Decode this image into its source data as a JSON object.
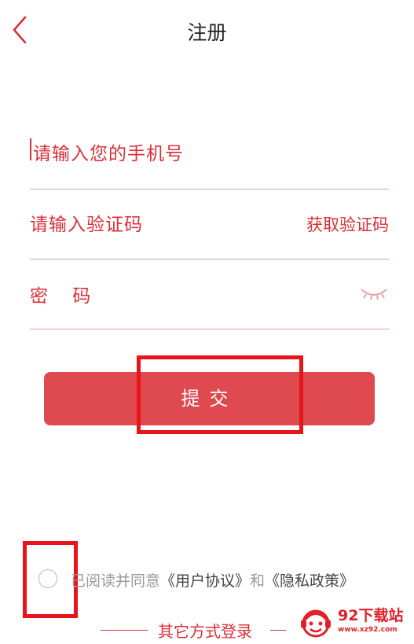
{
  "header": {
    "back_icon": "chevron-left-icon",
    "title": "注册"
  },
  "form": {
    "phone_placeholder": "请输入您的手机号",
    "code_placeholder": "请输入验证码",
    "get_code_label": "获取验证码",
    "password_placeholder": "密 码",
    "password_toggle_icon": "eye-closed-icon",
    "submit_label": "提交"
  },
  "agreement": {
    "prefix": "已阅读并同意",
    "user_agreement": "《用户协议》",
    "and": "和",
    "privacy_policy": "《隐私政策》"
  },
  "other_login": {
    "label": "其它方式登录"
  },
  "watermark": {
    "name": "92下载站",
    "url": "www.xz92.com"
  },
  "colors": {
    "accent": "#d8303a",
    "button": "#df4a50",
    "annotation": "#e8141c"
  }
}
